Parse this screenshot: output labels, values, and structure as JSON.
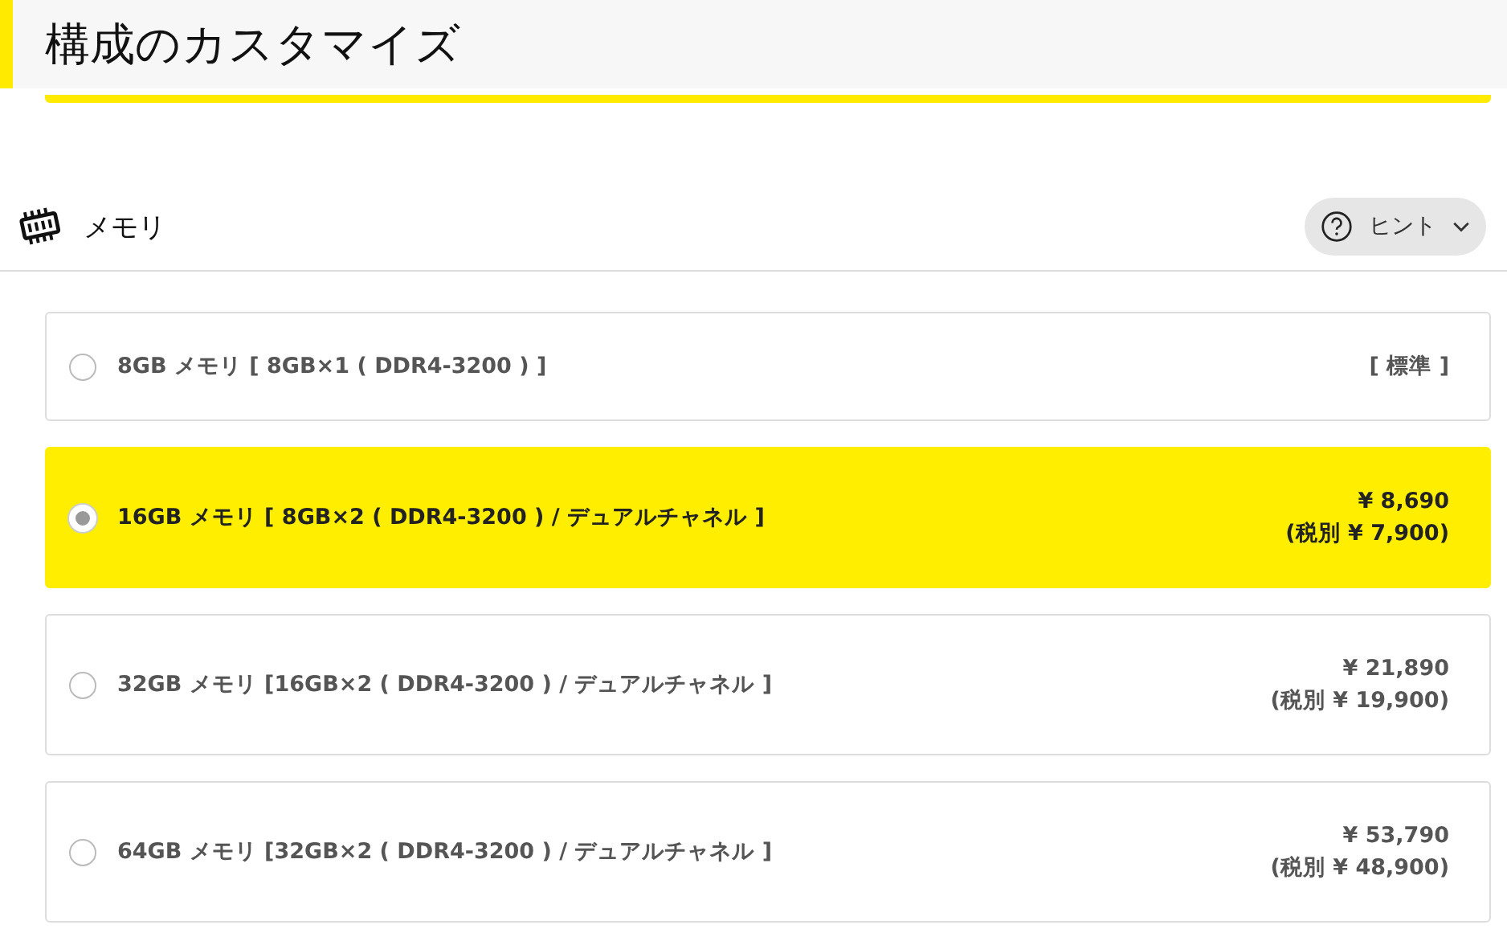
{
  "page_title": "構成のカスタマイズ",
  "section": {
    "title": "メモリ",
    "hint_button": "ヒント"
  },
  "options": [
    {
      "label": "8GB メモリ [ 8GB×1 ( DDR4-3200 ) ]",
      "selected": false,
      "price_lines": [
        "[ 標準 ]"
      ]
    },
    {
      "label": "16GB メモリ [ 8GB×2 ( DDR4-3200 ) / デュアルチャネル ]",
      "selected": true,
      "price_lines": [
        "¥ 8,690",
        "(税別 ¥ 7,900)"
      ]
    },
    {
      "label": "32GB メモリ [16GB×2 ( DDR4-3200 ) / デュアルチャネル ]",
      "selected": false,
      "price_lines": [
        "¥ 21,890",
        "(税別 ¥ 19,900)"
      ]
    },
    {
      "label": "64GB メモリ [32GB×2 ( DDR4-3200 ) / デュアルチャネル ]",
      "selected": false,
      "price_lines": [
        "¥ 53,790",
        "(税別 ¥ 48,900)"
      ]
    }
  ]
}
